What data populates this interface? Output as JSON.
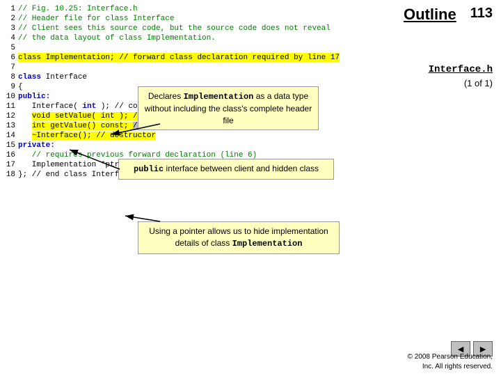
{
  "page": {
    "number": "113",
    "outline_label": "Outline",
    "interface_h_label": "Interface.h",
    "of_label": "(1 of 1)"
  },
  "code": {
    "lines": [
      {
        "num": "1",
        "text": "// Fig. 10.25: Interface.h",
        "style": "green"
      },
      {
        "num": "2",
        "text": "// Header file for class Interface",
        "style": "green"
      },
      {
        "num": "3",
        "text": "// Client sees this source code, but the source code does not reveal",
        "style": "green"
      },
      {
        "num": "4",
        "text": "// the data layout of class Implementation.",
        "style": "green"
      },
      {
        "num": "5",
        "text": "",
        "style": "normal"
      },
      {
        "num": "6",
        "text": "class Implementation; // forward class declaration required by line 17",
        "style": "highlight"
      },
      {
        "num": "7",
        "text": "",
        "style": "normal"
      },
      {
        "num": "8",
        "text": "class Interface",
        "style": "blue-kw"
      },
      {
        "num": "9",
        "text": "{",
        "style": "normal"
      },
      {
        "num": "10",
        "text": "public:",
        "style": "blue-kw"
      },
      {
        "num": "11",
        "text": "   Interface( int ); // constructor",
        "style": "normal"
      },
      {
        "num": "12",
        "text": "   void setValue( int ); // same public interface as",
        "style": "yellow"
      },
      {
        "num": "13",
        "text": "   int getValue() const; // class Implementation has",
        "style": "yellow"
      },
      {
        "num": "14",
        "text": "   ~Interface(); // destructor",
        "style": "yellow"
      },
      {
        "num": "15",
        "text": "private:",
        "style": "blue-kw"
      },
      {
        "num": "16",
        "text": "   // requires previous forward declaration (line 6)",
        "style": "green"
      },
      {
        "num": "17",
        "text": "   Implementation *ptr;",
        "style": "normal"
      },
      {
        "num": "18",
        "text": "}; // end class Interface",
        "style": "normal"
      }
    ]
  },
  "tooltips": {
    "declares": {
      "line1": "Declares ",
      "mono": "Implementation",
      "line2": " as a data type",
      "line3": "without including the class's complete header file"
    },
    "public_interface": {
      "line1": "public interface between client and hidden class"
    },
    "pointer": {
      "line1": "Using a pointer allows us to hide implementation",
      "line2": "details of class ",
      "mono": "Implementation"
    }
  },
  "nav": {
    "back_label": "◄",
    "forward_label": "►"
  },
  "copyright": {
    "line1": "© 2008 Pearson Education,",
    "line2": "Inc.  All rights reserved."
  }
}
